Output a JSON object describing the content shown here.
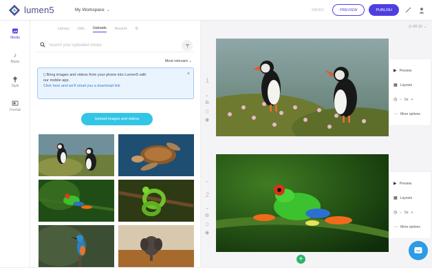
{
  "app": {
    "name": "lumen5",
    "workspace": "My Workspace"
  },
  "top": {
    "saved": "SAVED",
    "preview": "PREVIEW",
    "publish": "PUBLISH"
  },
  "rail": [
    {
      "label": "Media",
      "icon": "image-icon"
    },
    {
      "label": "Music",
      "icon": "music-note-icon"
    },
    {
      "label": "Style",
      "icon": "paint-icon"
    },
    {
      "label": "Format",
      "icon": "format-icon"
    }
  ],
  "panel": {
    "tabs": [
      "Library",
      "Gifs",
      "Uploads",
      "Recent",
      "⚙"
    ],
    "active_tab": "Uploads",
    "search_placeholder": "Search your uploaded media",
    "sort": "Most relevant",
    "banner_line1": "Bring images and videos from your phone into Lumen5 with",
    "banner_line2": "our mobile app.",
    "banner_link": "Click here and we'll email you a download link",
    "upload_button": "Upload images and videos",
    "thumbnails": [
      "puffins",
      "sea-turtle",
      "tree-frog",
      "green-snake",
      "kingfisher",
      "elephant"
    ]
  },
  "canvas": {
    "duration": "00:10",
    "scenes": [
      {
        "number": "1",
        "subject": "puffins"
      },
      {
        "number": "2",
        "subject": "tree-frog"
      }
    ],
    "options": {
      "preview": "Preview",
      "layouts": "Layouts",
      "duration": "5s",
      "more": "More options"
    }
  },
  "colors": {
    "accent": "#4f3fe0",
    "upload": "#33c5e6",
    "add": "#2cb66a",
    "chat": "#2d9be6"
  }
}
